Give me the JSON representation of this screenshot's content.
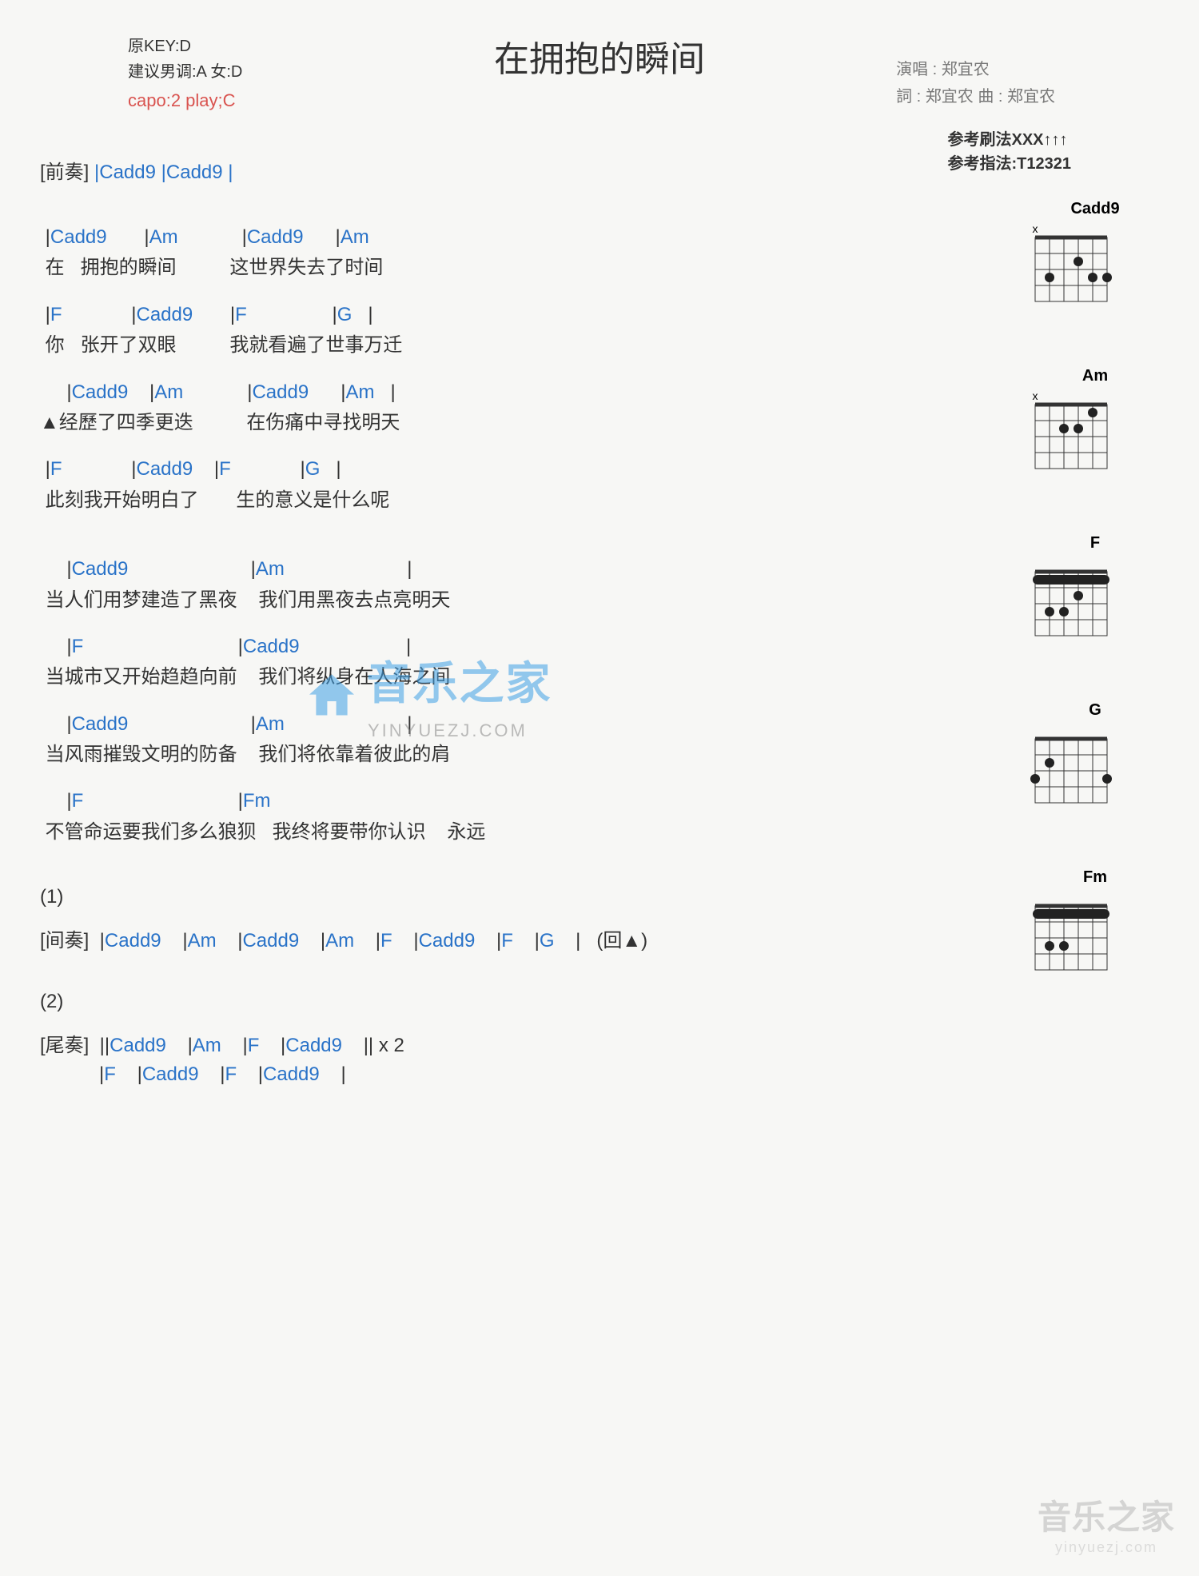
{
  "title": "在拥抱的瞬间",
  "meta": {
    "original_key": "原KEY:D",
    "suggested_key": "建议男调:A 女:D",
    "capo": "capo:2 play;C",
    "singer": "演唱 : 郑宜农",
    "credits": "詞 : 郑宜农  曲 : 郑宜农",
    "strum": "参考刷法XXX↑↑↑",
    "finger": "参考指法:T12321"
  },
  "sections": {
    "intro_label": "[前奏]",
    "intro_chords": "|Cadd9    |Cadd9    |",
    "verse1": {
      "l1_chords": " |Cadd9       |Am            |Cadd9      |Am",
      "l1_lyric": " 在   拥抱的瞬间          这世界失去了时间",
      "l2_chords": " |F             |Cadd9       |F                |G   |",
      "l2_lyric": " 你   张开了双眼          我就看遍了世事万迁",
      "l3_chords": "     |Cadd9    |Am            |Cadd9      |Am   |",
      "l3_lyric": "▲经歷了四季更迭          在伤痛中寻找明天",
      "l4_chords": " |F             |Cadd9    |F             |G   |",
      "l4_lyric": " 此刻我开始明白了       生的意义是什么呢"
    },
    "chorus": {
      "l1_chords": "     |Cadd9                       |Am                       |",
      "l1_lyric": " 当人们用梦建造了黑夜    我们用黑夜去点亮明天",
      "l2_chords": "     |F                             |Cadd9                    |",
      "l2_lyric": " 当城市又开始趋趋向前    我们将纵身在人海之间",
      "l3_chords": "     |Cadd9                       |Am                       |",
      "l3_lyric": " 当风雨摧毁文明的防备    我们将依靠着彼此的肩",
      "l4_chords": "     |F                             |Fm",
      "l4_lyric": " 不管命运要我们多么狼狈   我终将要带你认识    永远"
    },
    "num1": "(1)",
    "interlude_label": "[间奏]",
    "interlude_chords": "|Cadd9    |Am    |Cadd9    |Am    |F    |Cadd9    |F    |G    |   (回▲)",
    "num2": "(2)",
    "outro_label": "[尾奏]",
    "outro_chords_1": "||Cadd9    |Am    |F    |Cadd9    || x 2",
    "outro_chords_2": "|F    |Cadd9    |F    |Cadd9    |"
  },
  "chord_diagrams": [
    "Cadd9",
    "Am",
    "F",
    "G",
    "Fm"
  ],
  "watermark": {
    "name": "音乐之家",
    "url": "YINYUEZJ.COM",
    "corner_name": "音乐之家",
    "corner_url": "yinyuezj.com"
  },
  "chart_data": {
    "type": "table",
    "description": "Guitar chord/lyric sheet",
    "chords_used": [
      "Cadd9",
      "Am",
      "F",
      "G",
      "Fm"
    ],
    "capo": 2,
    "play_key": "C",
    "original_key": "D"
  }
}
